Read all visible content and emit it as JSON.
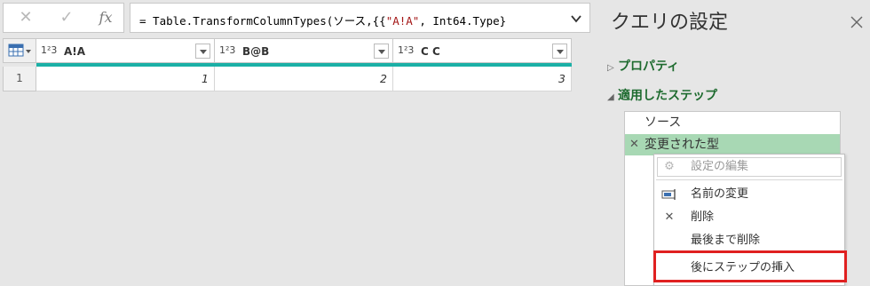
{
  "formula_bar": {
    "cancel_icon": "✕",
    "confirm_icon": "✓",
    "fx_label": "fx",
    "prefix": "= Table.TransformColumnTypes(ソース,{{",
    "string_literal": "\"A!A\"",
    "suffix": ", Int64.Type}",
    "chevron_icon": "chevron-down-icon"
  },
  "grid": {
    "columns": [
      {
        "type_label": "1²3",
        "name": "A!A"
      },
      {
        "type_label": "1²3",
        "name": "B@B"
      },
      {
        "type_label": "1²3",
        "name": "C C"
      }
    ],
    "rows": [
      {
        "row_number": "1",
        "cells": [
          "1",
          "2",
          "3"
        ]
      }
    ],
    "accent_color": "#1bb0a6"
  },
  "query_settings": {
    "title": "クエリの設定",
    "close_icon": "close-icon",
    "properties_label": "プロパティ",
    "applied_steps_label": "適用したステップ",
    "steps": [
      {
        "label": "ソース"
      },
      {
        "label": "変更された型",
        "delete_glyph": "✕"
      }
    ],
    "section_color": "#1e6b2f",
    "selected_color": "#a8d8b4"
  },
  "context_menu": {
    "items": [
      {
        "label": "設定の編集",
        "icon": "gear-icon",
        "glyph": "⚙",
        "enabled": false
      },
      {
        "label": "名前の変更",
        "icon": "rename-icon",
        "glyph": "▭",
        "enabled": true
      },
      {
        "label": "削除",
        "icon": "delete-icon",
        "glyph": "✕",
        "enabled": true
      },
      {
        "label": "最後まで削除",
        "icon": "",
        "glyph": "",
        "enabled": true
      },
      {
        "label": "後にステップの挿入",
        "icon": "",
        "glyph": "",
        "enabled": true
      }
    ],
    "highlight_color": "#e02020"
  }
}
